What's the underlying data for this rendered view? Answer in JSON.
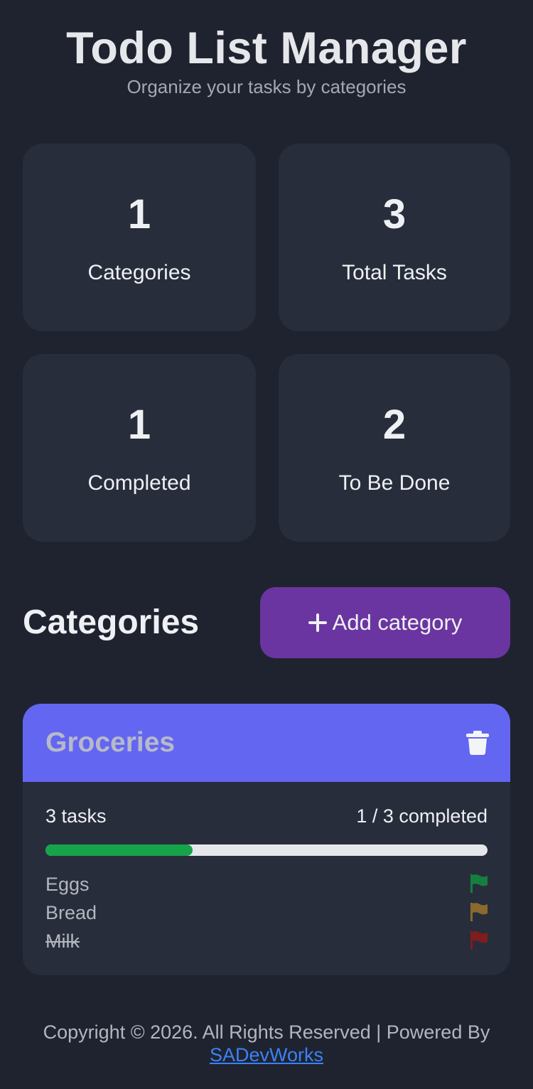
{
  "header": {
    "title": "Todo List Manager",
    "subtitle": "Organize your tasks by categories"
  },
  "stats": [
    {
      "value": "1",
      "label": "Categories"
    },
    {
      "value": "3",
      "label": "Total Tasks"
    },
    {
      "value": "1",
      "label": "Completed"
    },
    {
      "value": "2",
      "label": "To Be Done"
    }
  ],
  "categories_section": {
    "title": "Categories",
    "add_button_label": "Add category"
  },
  "category": {
    "name": "Groceries",
    "header_color": "#6366f1",
    "task_count": "3 tasks",
    "completed_text": "1 / 3 completed",
    "progress_fraction": 0.333,
    "tasks": [
      {
        "name": "Eggs",
        "completed": false,
        "flag_color": "#15803d"
      },
      {
        "name": "Bread",
        "completed": false,
        "flag_color": "#8a6a2e"
      },
      {
        "name": "Milk",
        "completed": true,
        "flag_color": "#7f1d1d"
      }
    ]
  },
  "footer": {
    "text": "Copyright © 2026. All Rights Reserved | Powered By",
    "link_text": "SADevWorks"
  },
  "colors": {
    "background": "#1f2330",
    "card": "#282d3b",
    "accent_button": "#6a35a0",
    "progress": "#16a34a",
    "link": "#3b82f6"
  }
}
